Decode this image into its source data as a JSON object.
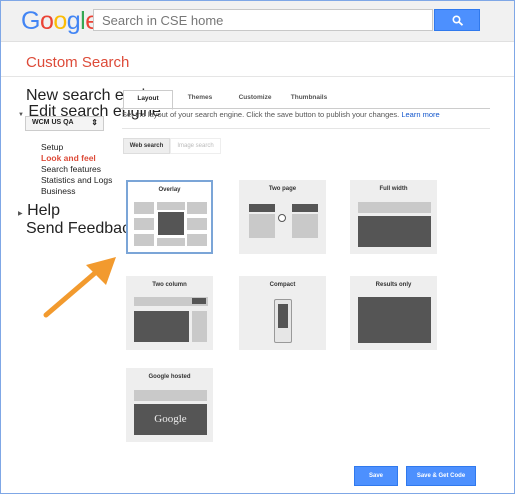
{
  "header": {
    "logo_letters": [
      {
        "ch": "G",
        "color": "#4285f4"
      },
      {
        "ch": "o",
        "color": "#ea4335"
      },
      {
        "ch": "o",
        "color": "#fbbc05"
      },
      {
        "ch": "g",
        "color": "#4285f4"
      },
      {
        "ch": "l",
        "color": "#34a853"
      },
      {
        "ch": "e",
        "color": "#ea4335"
      }
    ],
    "search_placeholder": "Search in CSE home",
    "search_icon": "magnifier-icon"
  },
  "page": {
    "title": "Custom Search"
  },
  "sidebar": {
    "new_engine": "New search engine",
    "edit_engine": "Edit search engine",
    "engine_select_value": "WCM US QA",
    "sub_items": [
      "Setup",
      "Look and feel",
      "Search features",
      "Statistics and Logs",
      "Business"
    ],
    "active_sub_item": "Look and feel",
    "help": "Help",
    "send_feedback": "Send Feedback"
  },
  "tabs": [
    "Layout",
    "Themes",
    "Customize",
    "Thumbnails"
  ],
  "active_tab": "Layout",
  "description": {
    "text": "Set the layout of your search engine. Click the save button to publish your changes. ",
    "link": "Learn more"
  },
  "search_type_tabs": {
    "web": "Web search",
    "image": "Image search"
  },
  "layouts": [
    {
      "label": "Overlay",
      "selected": true
    },
    {
      "label": "Two page",
      "selected": false
    },
    {
      "label": "Full width",
      "selected": false
    },
    {
      "label": "Two column",
      "selected": false
    },
    {
      "label": "Compact",
      "selected": false
    },
    {
      "label": "Results only",
      "selected": false
    },
    {
      "label": "Google hosted",
      "selected": false
    }
  ],
  "google_hosted_logo": "Google",
  "buttons": {
    "save": "Save",
    "save_get_code": "Save & Get Code"
  },
  "colors": {
    "accent_red": "#dd4b39",
    "button_blue": "#4d90fe",
    "arrow_orange": "#f29a2e",
    "selected_border": "#7ba5d7"
  }
}
